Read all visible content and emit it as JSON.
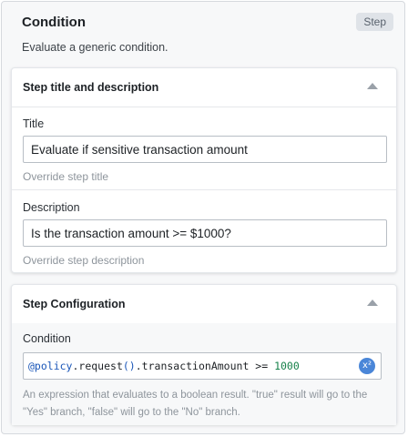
{
  "header": {
    "title": "Condition",
    "badge": "Step",
    "description": "Evaluate a generic condition."
  },
  "title_card": {
    "heading": "Step title and description",
    "title_field": {
      "label": "Title",
      "value": "Evaluate if sensitive transaction amount",
      "help": "Override step title"
    },
    "description_field": {
      "label": "Description",
      "value": "Is the transaction amount >= $1000?",
      "help": "Override step description"
    }
  },
  "config_card": {
    "heading": "Step Configuration",
    "condition": {
      "label": "Condition",
      "code": {
        "decorator": "@policy",
        "dot1": ".",
        "call": "request",
        "parens": "()",
        "dot2": ".",
        "prop": "transactionAmount",
        "op": " >= ",
        "number": "1000"
      },
      "help": "An expression that evaluates to a boolean result. \"true\" result will go to the \"Yes\" branch, \"false\" will go to the \"No\" branch."
    }
  }
}
